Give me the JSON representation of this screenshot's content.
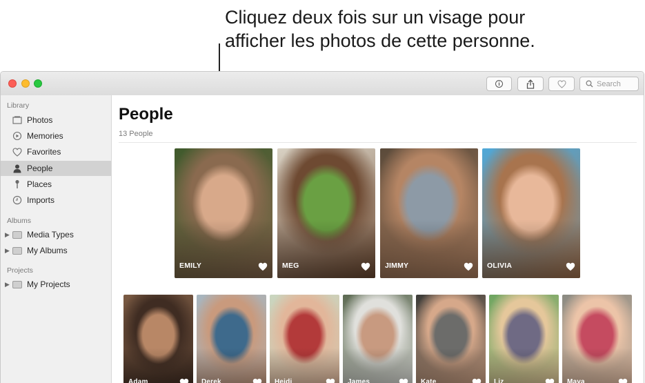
{
  "callout": {
    "line1": "Cliquez deux fois sur un visage pour",
    "line2": "afficher les photos de cette personne."
  },
  "toolbar": {
    "info_icon": "info-icon",
    "share_icon": "share-icon",
    "favorite_icon": "heart-icon",
    "search_placeholder": "Search"
  },
  "sidebar": {
    "sections": [
      {
        "label": "Library",
        "items": [
          {
            "label": "Photos",
            "icon": "photos-icon",
            "selected": false
          },
          {
            "label": "Memories",
            "icon": "memories-icon",
            "selected": false
          },
          {
            "label": "Favorites",
            "icon": "heart-icon",
            "selected": false
          },
          {
            "label": "People",
            "icon": "person-icon",
            "selected": true
          },
          {
            "label": "Places",
            "icon": "pin-icon",
            "selected": false
          },
          {
            "label": "Imports",
            "icon": "clock-icon",
            "selected": false
          }
        ]
      },
      {
        "label": "Albums",
        "items": [
          {
            "label": "Media Types",
            "icon": "folder-icon"
          },
          {
            "label": "My Albums",
            "icon": "folder-icon"
          }
        ]
      },
      {
        "label": "Projects",
        "items": [
          {
            "label": "My Projects",
            "icon": "folder-icon"
          }
        ]
      }
    ]
  },
  "main": {
    "title": "People",
    "count": "13 People",
    "favorites": [
      {
        "name": "EMILY",
        "palette": [
          "#3f5a2c",
          "#8a6a4f",
          "#d8a98a"
        ]
      },
      {
        "name": "MEG",
        "palette": [
          "#d9d2c4",
          "#6e4a32",
          "#6aa043"
        ]
      },
      {
        "name": "JIMMY",
        "palette": [
          "#5a4a3a",
          "#b58564",
          "#8d9aa6"
        ]
      },
      {
        "name": "OLIVIA",
        "palette": [
          "#4fa8d8",
          "#a8744e",
          "#e8b89a"
        ]
      }
    ],
    "others": [
      {
        "name": "Adam",
        "palette": [
          "#7a5a43",
          "#3f2c22",
          "#b88766"
        ]
      },
      {
        "name": "Derek",
        "palette": [
          "#a7b6c0",
          "#c99a7d",
          "#3e6a8c"
        ]
      },
      {
        "name": "Heidi",
        "palette": [
          "#c9d6c0",
          "#e2b69a",
          "#b33a3a"
        ]
      },
      {
        "name": "James",
        "palette": [
          "#5c6a52",
          "#e0e0dc",
          "#c89a80"
        ]
      },
      {
        "name": "Kate",
        "palette": [
          "#3b3b38",
          "#d6a88a",
          "#6c6c6a"
        ]
      },
      {
        "name": "Liz",
        "palette": [
          "#6da560",
          "#e5c79b",
          "#6f6a84"
        ]
      },
      {
        "name": "Maya",
        "palette": [
          "#8a8a82",
          "#ecc4a8",
          "#c54b60"
        ]
      }
    ]
  }
}
